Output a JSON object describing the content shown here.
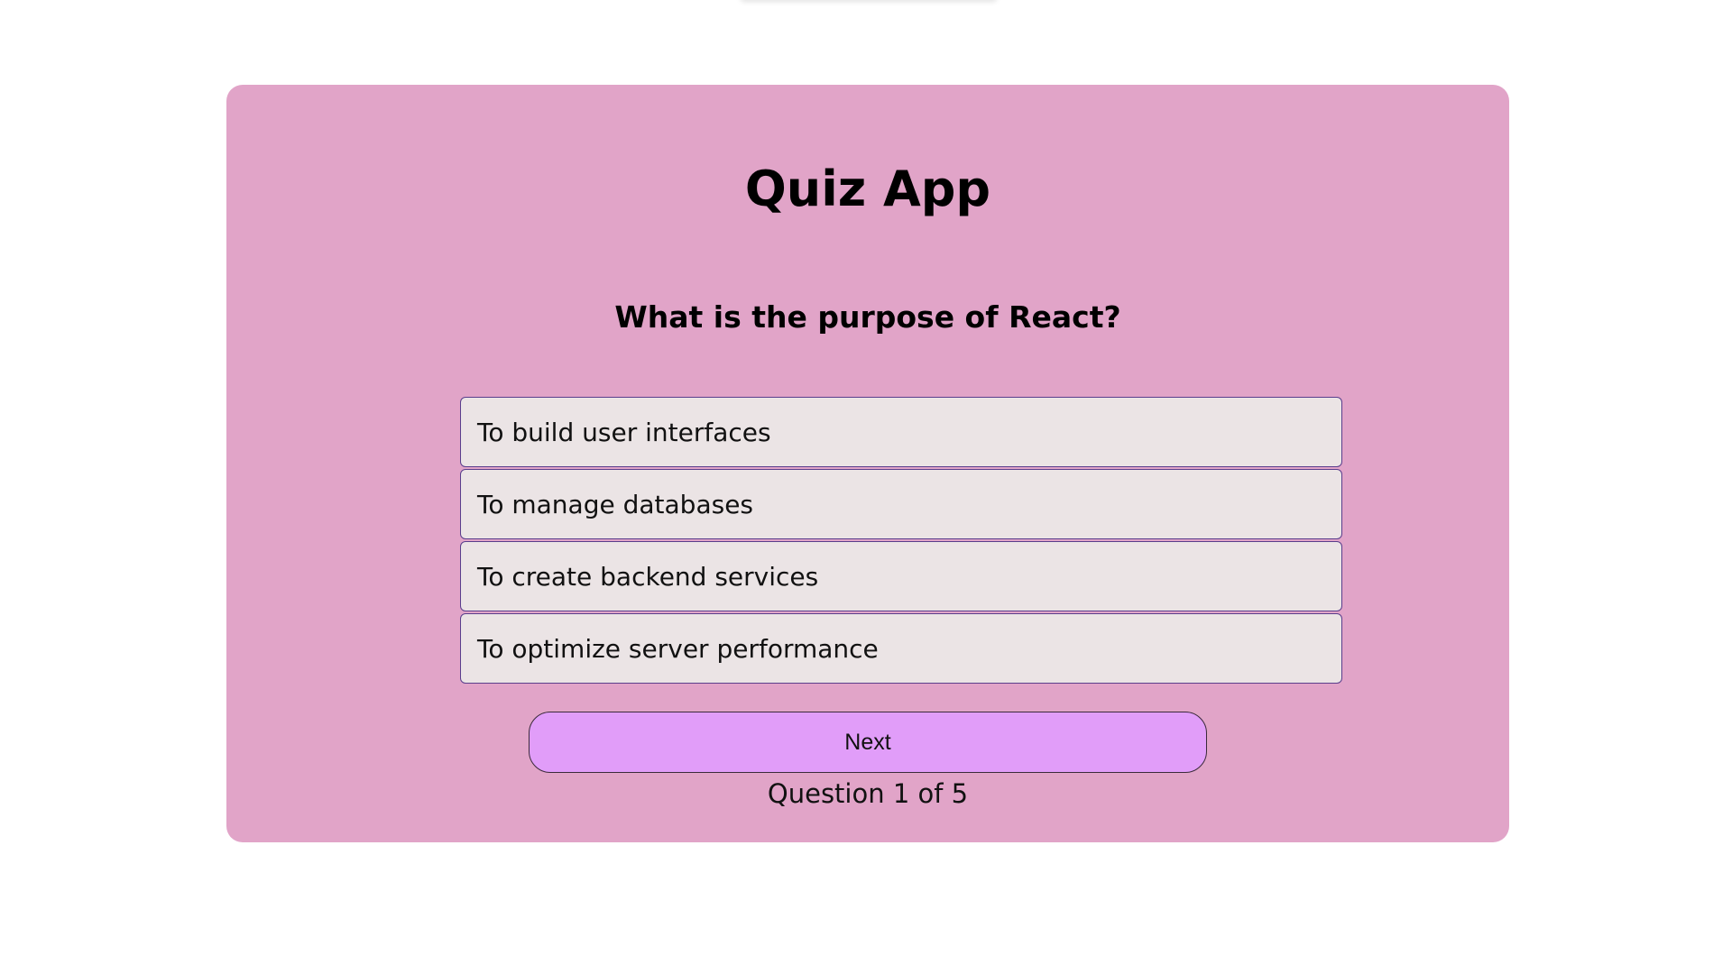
{
  "app": {
    "title": "Quiz App"
  },
  "question": {
    "text": "What is the purpose of React?",
    "options": [
      {
        "label": "To build user interfaces"
      },
      {
        "label": "To manage databases"
      },
      {
        "label": "To create backend services"
      },
      {
        "label": "To optimize server performance"
      }
    ]
  },
  "controls": {
    "next_label": "Next"
  },
  "progress": {
    "text": "Question 1 of 5",
    "current": 1,
    "total": 5
  },
  "colors": {
    "card_background": "#e1a4c8",
    "option_background": "#ebe4e5",
    "option_border": "#5a3e8c",
    "next_button_background": "#e19df9"
  }
}
